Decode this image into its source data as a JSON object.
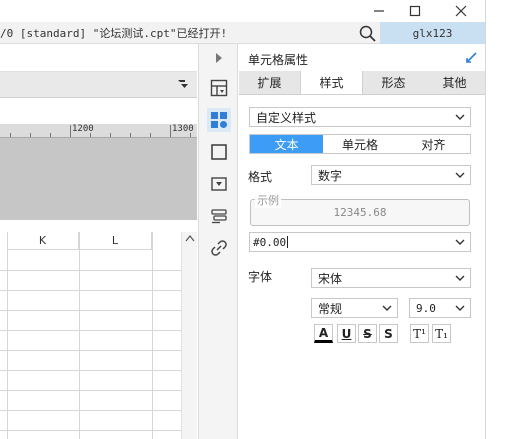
{
  "window": {
    "minimize_glyph": "—",
    "maximize_glyph": "☐",
    "close_glyph": "✕"
  },
  "infobar": {
    "message": "/0 [standard] \"论坛测试.cpt\"已经打开!",
    "user": "glx123",
    "search_icon": "search-icon"
  },
  "canvas": {
    "ruler_labels": [
      "1200",
      "1300"
    ],
    "columns": [
      "K",
      "L"
    ]
  },
  "iconbar": {
    "items": [
      "expand-arrow-icon",
      "cell-element-icon",
      "cell-attribute-icon",
      "border-icon",
      "widget-icon",
      "condition-icon",
      "hyperlink-icon"
    ]
  },
  "panel": {
    "title": "单元格属性",
    "tabs": [
      {
        "label": "扩展"
      },
      {
        "label": "样式"
      },
      {
        "label": "形态"
      },
      {
        "label": "其他"
      }
    ],
    "style_select": "自定义样式",
    "segments": [
      {
        "label": "文本"
      },
      {
        "label": "单元格"
      },
      {
        "label": "对齐"
      }
    ],
    "format_label": "格式",
    "format_value": "数字",
    "example_legend": "示例",
    "example_value": "12345.68",
    "format_pattern": "#0.00",
    "font_label": "字体",
    "font_family": "宋体",
    "font_style": "常规",
    "font_size": "9.0",
    "style_buttons": [
      "A",
      "U",
      "S",
      "S",
      "T¹",
      "T₁"
    ]
  },
  "colors": {
    "accent": "#3d9cf5",
    "user_box": "#c9e0f3"
  }
}
